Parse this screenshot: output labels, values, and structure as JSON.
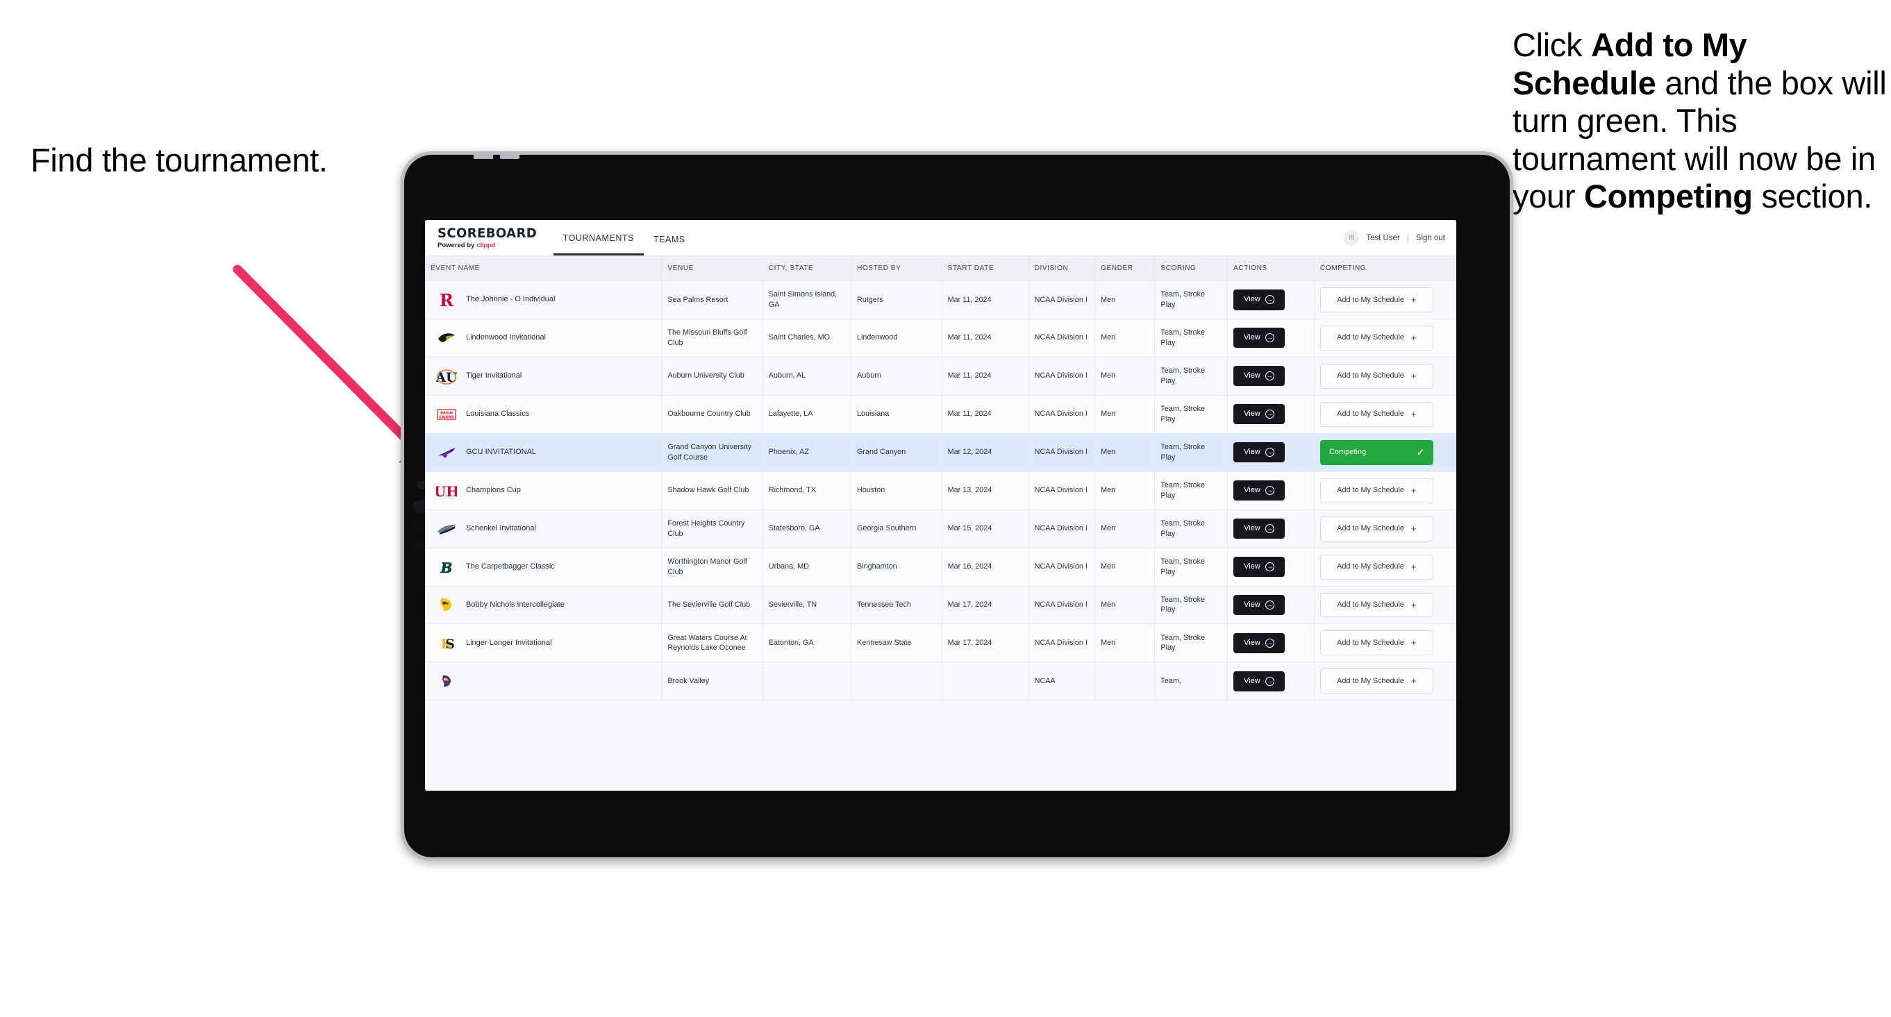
{
  "annotations": {
    "left": "Find the tournament.",
    "right_parts": [
      {
        "text": "Click ",
        "bold": false
      },
      {
        "text": "Add to My Schedule",
        "bold": true
      },
      {
        "text": " and the box will turn green. This tournament will now be in your ",
        "bold": false
      },
      {
        "text": "Competing",
        "bold": true
      },
      {
        "text": " section.",
        "bold": false
      }
    ],
    "arrow_color": "#ed2f64"
  },
  "app": {
    "brand_title": "SCOREBOARD",
    "brand_powered": "Powered by",
    "brand_name": "clippd",
    "nav": [
      {
        "label": "TOURNAMENTS",
        "active": true
      },
      {
        "label": "TEAMS",
        "active": false
      }
    ],
    "user": {
      "avatar_glyph": "⊞",
      "name": "Test User",
      "separator": "|",
      "signout": "Sign out"
    }
  },
  "table": {
    "columns": [
      "EVENT NAME",
      "VENUE",
      "CITY, STATE",
      "HOSTED BY",
      "START DATE",
      "DIVISION",
      "GENDER",
      "SCORING",
      "ACTIONS",
      "COMPETING"
    ],
    "view_label": "View",
    "add_label": "Add to My Schedule",
    "add_plus": "+",
    "competing_label": "Competing",
    "competing_tick": "✓",
    "competing_color": "#23a83f",
    "rows": [
      {
        "logo": "rutgers-logo",
        "event": "The Johnnie - O Individual",
        "venue": "Sea Palms Resort",
        "city": "Saint Simons Island, GA",
        "host": "Rutgers",
        "date": "Mar 11, 2024",
        "division": "NCAA Division I",
        "gender": "Men",
        "scoring": "Team, Stroke Play",
        "competing": false
      },
      {
        "logo": "lindenwood-logo",
        "event": "Lindenwood Invitational",
        "venue": "The Missouri Bluffs Golf Club",
        "city": "Saint Charles, MO",
        "host": "Lindenwood",
        "date": "Mar 11, 2024",
        "division": "NCAA Division I",
        "gender": "Men",
        "scoring": "Team, Stroke Play",
        "competing": false
      },
      {
        "logo": "auburn-logo",
        "event": "Tiger Invitational",
        "venue": "Auburn University Club",
        "city": "Auburn, AL",
        "host": "Auburn",
        "date": "Mar 11, 2024",
        "division": "NCAA Division I",
        "gender": "Men",
        "scoring": "Team, Stroke Play",
        "competing": false
      },
      {
        "logo": "louisiana-logo",
        "event": "Louisiana Classics",
        "venue": "Oakbourne Country Club",
        "city": "Lafayette, LA",
        "host": "Louisiana",
        "date": "Mar 11, 2024",
        "division": "NCAA Division I",
        "gender": "Men",
        "scoring": "Team, Stroke Play",
        "competing": false
      },
      {
        "logo": "gcu-logo",
        "event": "GCU INVITATIONAL",
        "venue": "Grand Canyon University Golf Course",
        "city": "Phoenix, AZ",
        "host": "Grand Canyon",
        "date": "Mar 12, 2024",
        "division": "NCAA Division I",
        "gender": "Men",
        "scoring": "Team, Stroke Play",
        "competing": true,
        "highlight": true
      },
      {
        "logo": "houston-logo",
        "event": "Champions Cup",
        "venue": "Shadow Hawk Golf Club",
        "city": "Richmond, TX",
        "host": "Houston",
        "date": "Mar 13, 2024",
        "division": "NCAA Division I",
        "gender": "Men",
        "scoring": "Team, Stroke Play",
        "competing": false
      },
      {
        "logo": "georgia-southern-logo",
        "event": "Schenkel Invitational",
        "venue": "Forest Heights Country Club",
        "city": "Statesboro, GA",
        "host": "Georgia Southern",
        "date": "Mar 15, 2024",
        "division": "NCAA Division I",
        "gender": "Men",
        "scoring": "Team, Stroke Play",
        "competing": false
      },
      {
        "logo": "binghamton-logo",
        "event": "The Carpetbagger Classic",
        "venue": "Worthington Manor Golf Club",
        "city": "Urbana, MD",
        "host": "Binghamton",
        "date": "Mar 16, 2024",
        "division": "NCAA Division I",
        "gender": "Men",
        "scoring": "Team, Stroke Play",
        "competing": false
      },
      {
        "logo": "tennessee-tech-logo",
        "event": "Bobby Nichols Intercollegiate",
        "venue": "The Sevierville Golf Club",
        "city": "Sevierville, TN",
        "host": "Tennessee Tech",
        "date": "Mar 17, 2024",
        "division": "NCAA Division I",
        "gender": "Men",
        "scoring": "Team, Stroke Play",
        "competing": false
      },
      {
        "logo": "kennesaw-logo",
        "event": "Linger Longer Invitational",
        "venue": "Great Waters Course At Reynolds Lake Oconee",
        "city": "Eatonton, GA",
        "host": "Kennesaw State",
        "date": "Mar 17, 2024",
        "division": "NCAA Division I",
        "gender": "Men",
        "scoring": "Team, Stroke Play",
        "competing": false
      },
      {
        "logo": "ecu-logo",
        "event": "",
        "venue": "Brook Valley",
        "city": "",
        "host": "",
        "date": "",
        "division": "NCAA",
        "gender": "",
        "scoring": "Team,",
        "competing": false,
        "partial": true
      }
    ]
  }
}
